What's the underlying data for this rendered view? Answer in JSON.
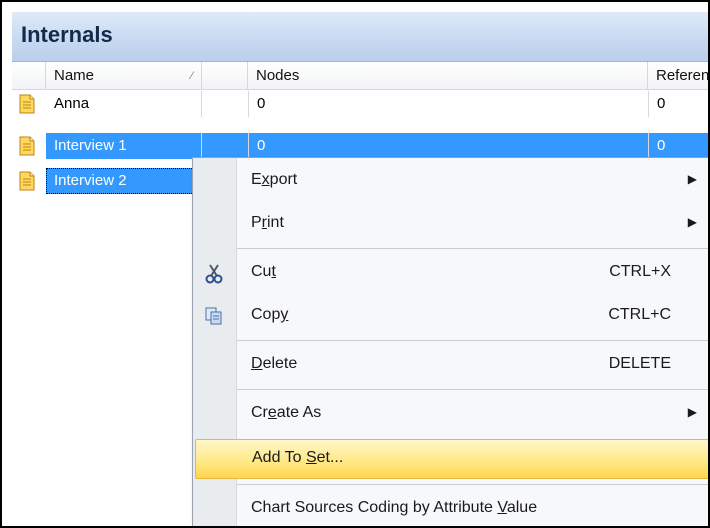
{
  "panel": {
    "title": "Internals"
  },
  "columns": {
    "name": "Name",
    "nodes": "Nodes",
    "references": "Referen"
  },
  "rows": [
    {
      "name": "Anna",
      "nodes": "0",
      "references": "0"
    },
    {
      "name": "Interview 1",
      "nodes": "0",
      "references": "0"
    },
    {
      "name": "Interview 2",
      "nodes": "",
      "references": ""
    }
  ],
  "menu": {
    "export": {
      "pre": "E",
      "key": "x",
      "post": "port"
    },
    "print": {
      "pre": "P",
      "key": "r",
      "post": "int"
    },
    "cut": {
      "pre": "Cu",
      "key": "t",
      "post": "",
      "shortcut": "CTRL+X"
    },
    "copy": {
      "pre": "Cop",
      "key": "y",
      "post": "",
      "shortcut": "CTRL+C"
    },
    "delete": {
      "pre": "",
      "key": "D",
      "post": "elete",
      "shortcut": "DELETE"
    },
    "create_as": {
      "pre": "Cr",
      "key": "e",
      "post": "ate As"
    },
    "add_to_set": {
      "pre": "Add To ",
      "key": "S",
      "post": "et..."
    },
    "chart_sources": {
      "pre": "Chart Sources Coding by Attribute ",
      "key": "V",
      "post": "alue"
    }
  },
  "colors": {
    "selection": "#3399ff",
    "menu_highlight": "#ffe98a",
    "header": "#c8daf1"
  }
}
